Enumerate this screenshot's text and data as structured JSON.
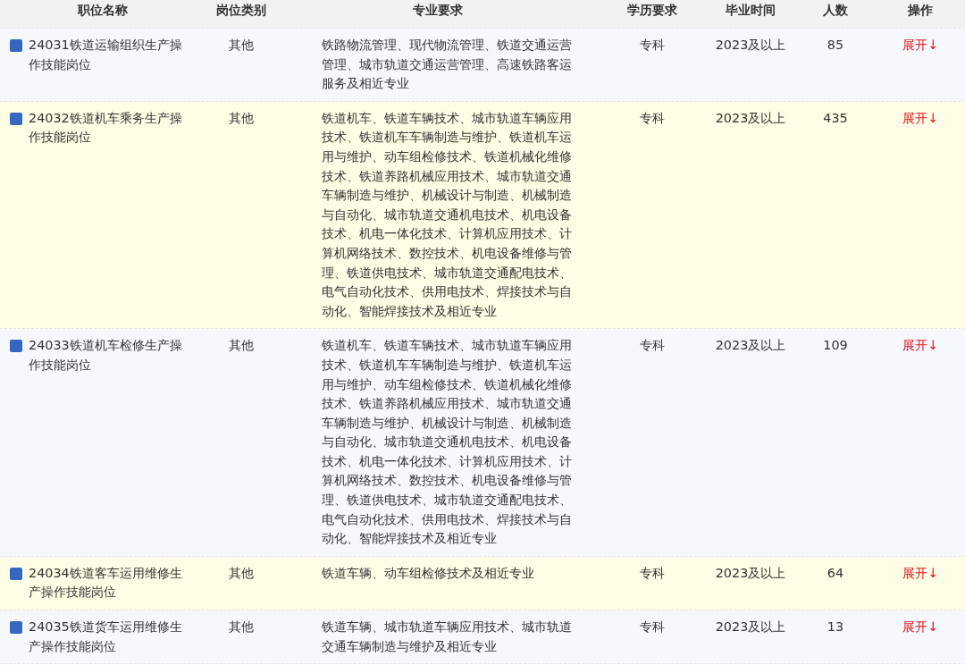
{
  "table": {
    "columns": [
      "职位名称",
      "岗位类别",
      "专业要求",
      "学历要求",
      "毕业时间",
      "人数",
      "操作"
    ],
    "rows": [
      {
        "name": "24031铁道运输组织生产操作技能岗位",
        "category": "其他",
        "major": "铁路物流管理、现代物流管理、铁道交通运营管理、城市轨道交通运营管理、高速铁路客运服务及相近专业",
        "education": "专科",
        "graduation": "2023及以上",
        "count": "85",
        "action": "展开↓"
      },
      {
        "name": "24032铁道机车乘务生产操作技能岗位",
        "category": "其他",
        "major": "铁道机车、铁道车辆技术、城市轨道车辆应用技术、铁道机车车辆制造与维护、铁道机车运用与维护、动车组检修技术、铁道机械化维修技术、铁道养路机械应用技术、城市轨道交通车辆制造与维护、机械设计与制造、机械制造与自动化、城市轨道交通机电技术、机电设备技术、机电一体化技术、计算机应用技术、计算机网络技术、数控技术、机电设备维修与管理、铁道供电技术、城市轨道交通配电技术、电气自动化技术、供用电技术、焊接技术与自动化、智能焊接技术及相近专业",
        "education": "专科",
        "graduation": "2023及以上",
        "count": "435",
        "action": "展开↓"
      },
      {
        "name": "24033铁道机车检修生产操作技能岗位",
        "category": "其他",
        "major": "铁道机车、铁道车辆技术、城市轨道车辆应用技术、铁道机车车辆制造与维护、铁道机车运用与维护、动车组检修技术、铁道机械化维修技术、铁道养路机械应用技术、城市轨道交通车辆制造与维护、机械设计与制造、机械制造与自动化、城市轨道交通机电技术、机电设备技术、机电一体化技术、计算机应用技术、计算机网络技术、数控技术、机电设备维修与管理、铁道供电技术、城市轨道交通配电技术、电气自动化技术、供用电技术、焊接技术与自动化、智能焊接技术及相近专业",
        "education": "专科",
        "graduation": "2023及以上",
        "count": "109",
        "action": "展开↓"
      },
      {
        "name": "24034铁道客车运用维修生产操作技能岗位",
        "category": "其他",
        "major": "铁道车辆、动车组检修技术及相近专业",
        "education": "专科",
        "graduation": "2023及以上",
        "count": "64",
        "action": "展开↓"
      },
      {
        "name": "24035铁道货车运用维修生产操作技能岗位",
        "category": "其他",
        "major": "铁道车辆、城市轨道车辆应用技术、城市轨道交通车辆制造与维护及相近专业",
        "education": "专科",
        "graduation": "2023及以上",
        "count": "13",
        "action": "展开↓"
      }
    ]
  }
}
